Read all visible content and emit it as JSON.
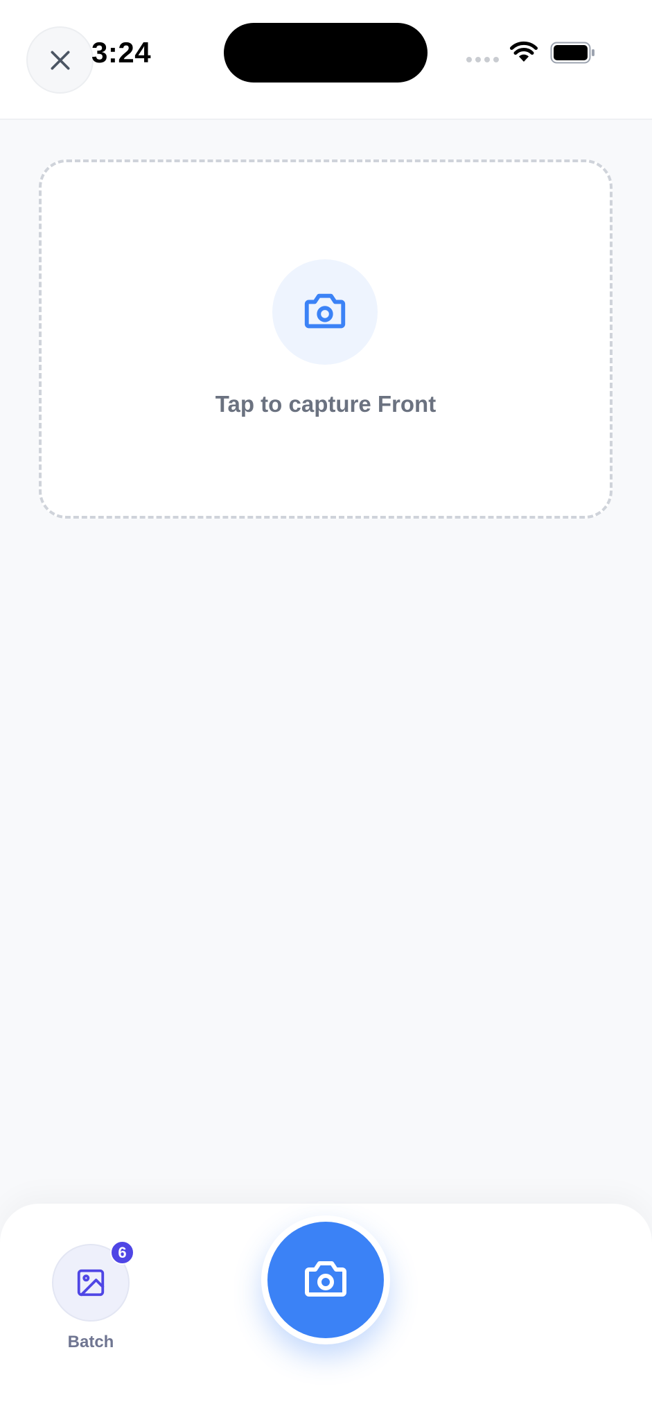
{
  "status_bar": {
    "time": "3:24"
  },
  "header": {
    "close_icon": "close-icon"
  },
  "capture": {
    "label": "Tap to capture Front",
    "icon": "camera-icon"
  },
  "bottom_bar": {
    "batch_label": "Batch",
    "batch_count": "6",
    "batch_icon": "image-icon",
    "shutter_icon": "camera-icon"
  },
  "colors": {
    "accent": "#3b82f6",
    "badge": "#4f46e5",
    "muted_text": "#6b7280"
  }
}
